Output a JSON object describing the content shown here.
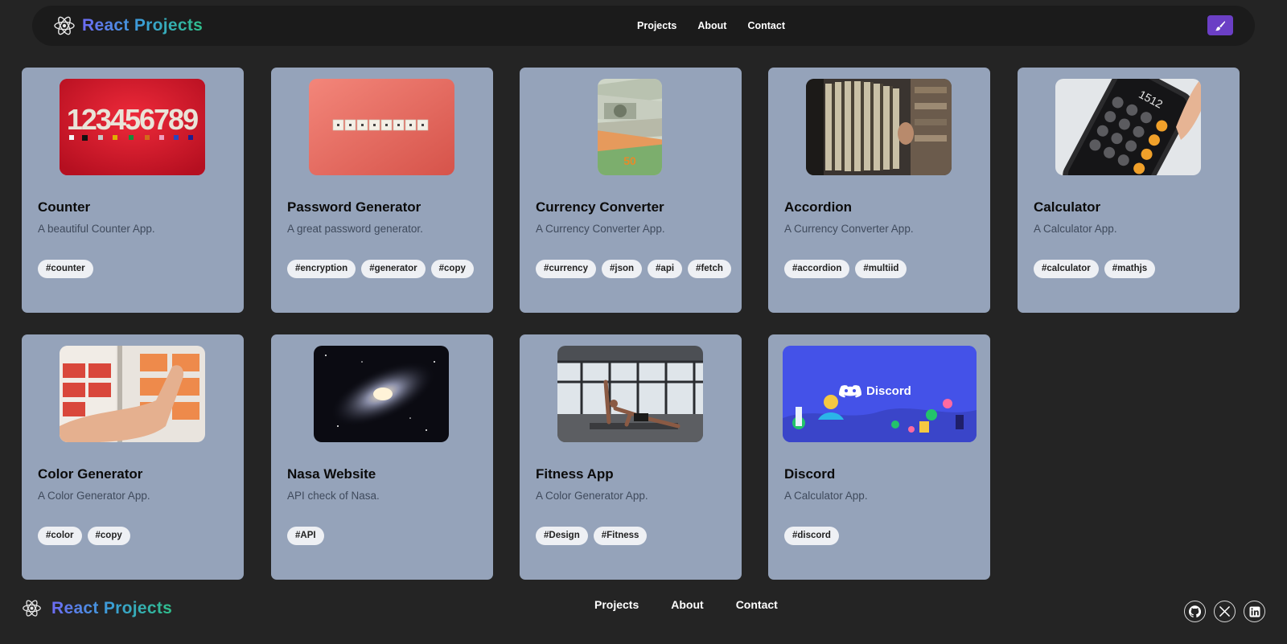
{
  "header": {
    "brand": "React Projects",
    "nav": [
      "Projects",
      "About",
      "Contact"
    ]
  },
  "colors": {
    "background": "#242424",
    "navbar": "#1b1b1b",
    "card": "#95a3ba",
    "tag_bg": "#eef0f4",
    "theme_button": "#6b3fc5",
    "brand_gradient": [
      "#6d6cf5",
      "#3a9fd6",
      "#2fbf8a"
    ]
  },
  "projects": [
    {
      "title": "Counter",
      "description": "A beautiful Counter App.",
      "tags": [
        "#counter"
      ],
      "image": "counter-numbers-image"
    },
    {
      "title": "Password Generator",
      "description": "A great password generator.",
      "tags": [
        "#encryption",
        "#generator",
        "#copy"
      ],
      "image": "password-tiles-image"
    },
    {
      "title": "Currency Converter",
      "description": "A Currency Converter App.",
      "tags": [
        "#currency",
        "#json",
        "#api",
        "#fetch"
      ],
      "image": "banknotes-image"
    },
    {
      "title": "Accordion",
      "description": "A Currency Converter App.",
      "tags": [
        "#accordion",
        "#multiid"
      ],
      "image": "accordion-instrument-image"
    },
    {
      "title": "Calculator",
      "description": "A Calculator App.",
      "tags": [
        "#calculator",
        "#mathjs"
      ],
      "image": "phone-calculator-image"
    },
    {
      "title": "Color Generator",
      "description": "A Color Generator App.",
      "tags": [
        "#color",
        "#copy"
      ],
      "image": "color-swatches-image"
    },
    {
      "title": "Nasa Website",
      "description": "API check of Nasa.",
      "tags": [
        "#API"
      ],
      "image": "spiral-galaxy-image"
    },
    {
      "title": "Fitness App",
      "description": "A Color Generator App.",
      "tags": [
        "#Design",
        "#Fitness"
      ],
      "image": "fitness-pose-image"
    },
    {
      "title": "Discord",
      "description": "A Calculator App.",
      "tags": [
        "#discord"
      ],
      "image": "discord-banner-image",
      "thumb_text": "Discord"
    }
  ],
  "footer": {
    "brand": "React Projects",
    "links": [
      "Projects",
      "About",
      "Contact"
    ],
    "socials": [
      "github-icon",
      "x-icon",
      "linkedin-icon"
    ]
  }
}
